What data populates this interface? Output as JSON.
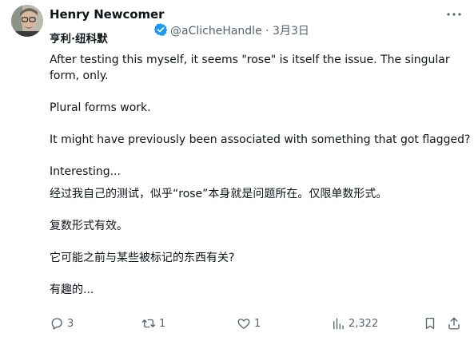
{
  "author": {
    "name": "Henry Newcomer",
    "name_translated": "亨利·纽科默",
    "handle": "@aClicheHandle",
    "date": "3月3日"
  },
  "tweet": {
    "paragraphs": [
      "After testing this myself, it seems \"rose\" is itself the issue. The singular",
      "form, only.",
      "Plural forms work.",
      "It might have previously been associated with something that got flagged?",
      "Interesting...",
      "经过我自己的测试，似乎“rose”本身就是问题所在。仅限单数形式。",
      "复数形式有效。",
      "它可能之前与某些被标记的东西有关?",
      "有趣的..."
    ]
  },
  "actions": {
    "replies": "3",
    "retweets": "1",
    "likes": "1",
    "views": "2,322"
  },
  "icons": {
    "verified": "verified-badge-icon",
    "more": "more-icon",
    "reply": "reply-icon",
    "retweet": "retweet-icon",
    "like": "heart-icon",
    "views": "views-icon",
    "bookmark": "bookmark-icon",
    "share": "share-icon"
  },
  "colors": {
    "verified_blue": "#1d9bf0",
    "secondary_text": "#536471",
    "primary_text": "#0f1419"
  }
}
